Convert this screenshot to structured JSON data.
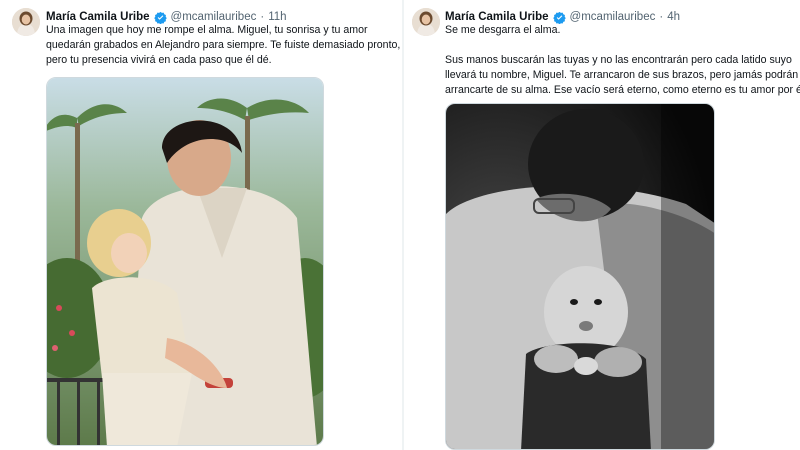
{
  "tweets": [
    {
      "author_name": "María Camila Uribe",
      "handle": "@mcamilauribec",
      "separator": "·",
      "time": "11h",
      "text_lines": [
        "Una imagen que hoy me rompe el alma. Miguel, tu sonrisa y tu amor",
        "quedarán grabados en Alejandro para siempre. Te fuiste demasiado pronto,",
        "pero tu presencia vivirá en cada paso que él dé."
      ]
    },
    {
      "author_name": "María Camila Uribe",
      "handle": "@mcamilauribec",
      "separator": "·",
      "time": "4h",
      "text_lines": [
        "Se me desgarra el alma.",
        "Sus manos buscarán las tuyas y no las encontrarán pero cada latido suyo",
        "llevará tu nombre, Miguel. Te arrancaron de sus brazos, pero jamás podrán",
        "arrancarte de su alma. Ese vacío será eterno, como eterno es tu amor por él."
      ]
    }
  ],
  "colors": {
    "verified_badge": "#1d9bf0",
    "secondary_text": "#536471",
    "divider": "#eff3f4"
  }
}
